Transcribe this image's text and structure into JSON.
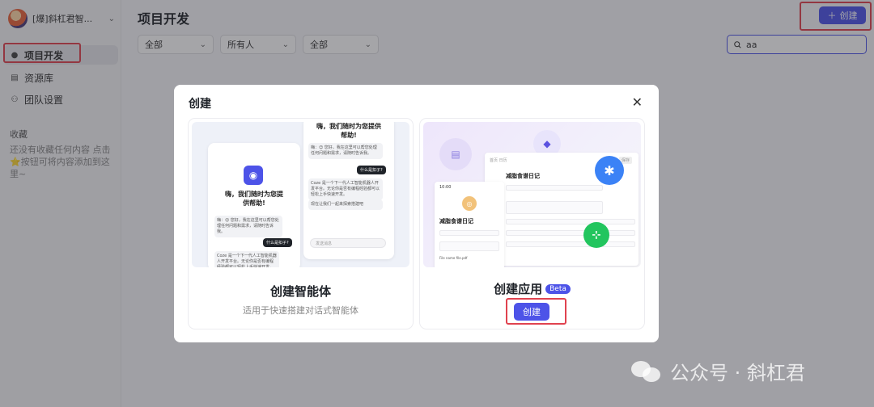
{
  "sidebar": {
    "workspace": "[爆]斜杠君智...",
    "items": [
      {
        "label": "项目开发",
        "icon": "robot-icon",
        "active": true
      },
      {
        "label": "资源库",
        "icon": "library-icon",
        "active": false
      },
      {
        "label": "团队设置",
        "icon": "team-icon",
        "active": false
      }
    ],
    "favorites_title": "收藏",
    "favorites_empty": "还没有收藏任何内容 点击⭐按钮可将内容添加到这里~"
  },
  "header": {
    "title": "项目开发",
    "create_label": "创建",
    "filters": [
      "全部",
      "所有人",
      "全部"
    ],
    "search_value": "aa"
  },
  "modal": {
    "title": "创建",
    "cards": [
      {
        "title": "创建智能体",
        "desc": "适用于快速搭建对话式智能体",
        "preview": {
          "greet": "嗨，我们随时为您提供帮助!",
          "bubble1": "嗨：😊 您好，我在这里可以帮您处理任何问题和需求，请随时告诉我。",
          "user_msg": "什么是扣子?",
          "bubble2": "Coze 是一个下一代人工智能机器人开发平台。无论你是否有编程经验都可以轻松上手快速开发。",
          "bubble3": "现在让我们一起来探索搭建吧",
          "input": "发送消息"
        }
      },
      {
        "title": "创建应用",
        "badge": "Beta",
        "button": "创建",
        "preview": {
          "app_title": "减脂食谱日记",
          "phone_time": "10:00",
          "file_name": "File name file.pdf",
          "nav": [
            "首页",
            "日历"
          ],
          "save": "保存"
        }
      }
    ]
  },
  "watermark": "公众号 · 斜杠君",
  "colors": {
    "accent": "#4d53e8",
    "highlight": "#e0424f"
  }
}
